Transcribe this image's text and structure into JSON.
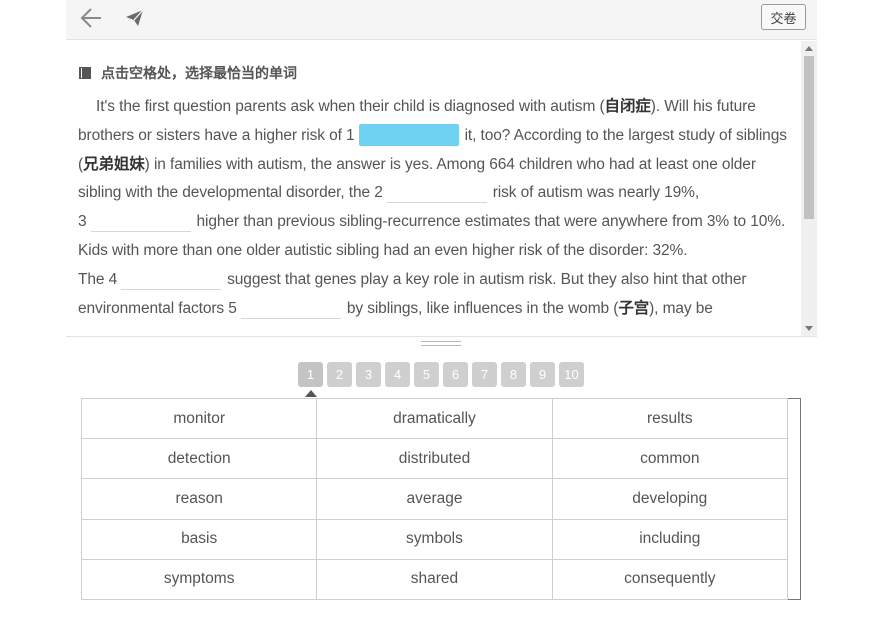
{
  "toolbar": {
    "submit_label": "交卷",
    "back_icon": "arrow-left-icon",
    "send_icon": "paper-plane-icon"
  },
  "instruction": "点击空格处，选择最恰当的单词",
  "passage": {
    "s1": "It's the first question parents ask when their child is diagnosed with autism (",
    "cn1": "自闭症",
    "s2": "). Will his future brothers or sisters have a higher risk of 1",
    "s3": "it, too? According to the largest study of siblings (",
    "cn2": "兄弟姐妹",
    "s4": ") in families with autism, the answer is yes. Among 664 children who had at least one older sibling with the developmental disorder, the 2",
    "s5": "risk of autism was nearly 19%,",
    "s6": "3",
    "s7": "higher than previous sibling-recurrence estimates that were anywhere from 3% to 10%. Kids with more than one older autistic sibling had an even higher risk of the disorder: 32%.",
    "s8": "The 4",
    "s9": "suggest that genes play a key role in autism risk. But they also hint that other environmental factors 5",
    "s10": "by siblings, like influences in the womb (",
    "cn3": "子宫",
    "s11": "), may be"
  },
  "question_nav": [
    "1",
    "2",
    "3",
    "4",
    "5",
    "6",
    "7",
    "8",
    "9",
    "10"
  ],
  "options": [
    [
      "monitor",
      "dramatically",
      "results"
    ],
    [
      "detection",
      "distributed",
      "common"
    ],
    [
      "reason",
      "average",
      "developing"
    ],
    [
      "basis",
      "symbols",
      "including"
    ],
    [
      "symptoms",
      "shared",
      "consequently"
    ]
  ],
  "colors": {
    "active_blank": "#6ed3f2",
    "toolbar_bg": "#f5f5f5",
    "nav_button": "#cfcfcf"
  }
}
